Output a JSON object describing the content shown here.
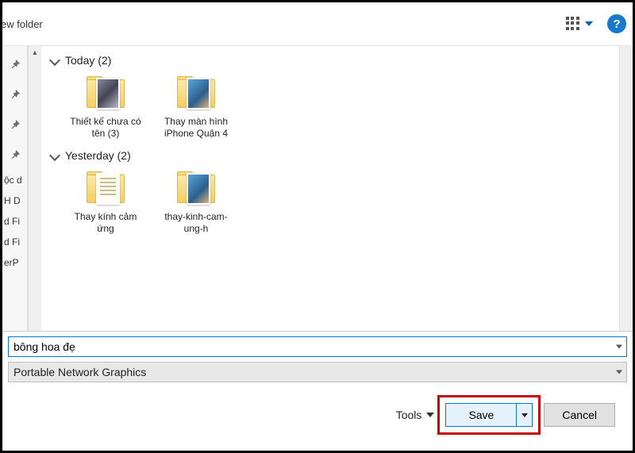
{
  "toolbar": {
    "new_folder_label": "ew folder",
    "help_label": "?"
  },
  "sidebar": {
    "items": [
      "ộc d",
      "H D",
      "d Fi",
      "d Fi",
      "erP"
    ]
  },
  "groups": [
    {
      "header": "Today (2)",
      "folders": [
        {
          "label": "Thiết kế chưa có tên (3)",
          "thumb": "dark"
        },
        {
          "label": "Thay màn hình iPhone Quận 4",
          "thumb": "alt"
        }
      ]
    },
    {
      "header": "Yesterday (2)",
      "folders": [
        {
          "label": "Thay kính cảm ứng",
          "thumb": "doc"
        },
        {
          "label": "thay-kinh-cam-ung-h",
          "thumb": "alt"
        }
      ]
    }
  ],
  "filename": {
    "value": "bông hoa đẹ"
  },
  "filetype": {
    "label": "Portable Network Graphics"
  },
  "actions": {
    "tools_label": "Tools",
    "save_label": "Save",
    "cancel_label": "Cancel"
  }
}
